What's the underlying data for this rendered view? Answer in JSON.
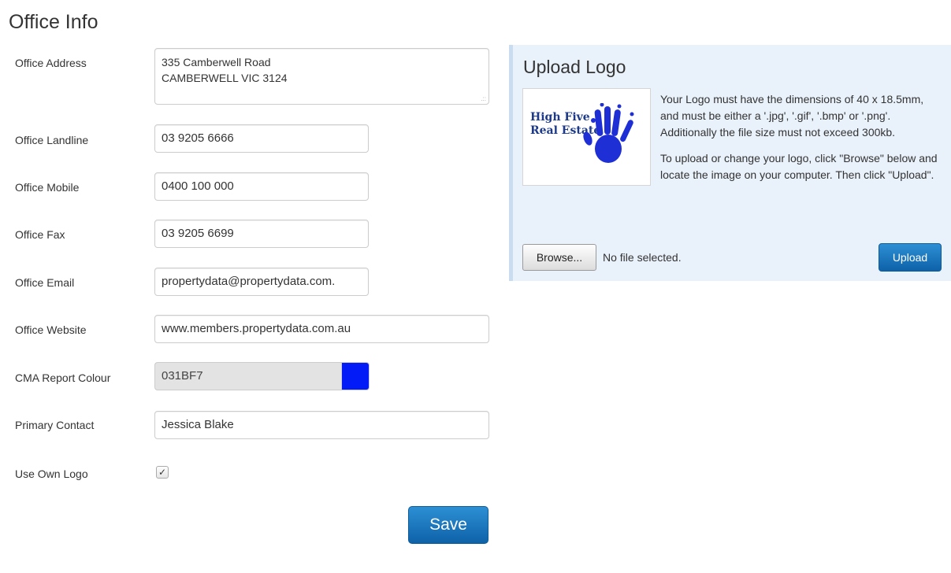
{
  "page_title": "Office Info",
  "form": {
    "address": {
      "label": "Office Address",
      "line1": "335 Camberwell Road",
      "line2": "CAMBERWELL VIC 3124"
    },
    "landline": {
      "label": "Office Landline",
      "value": "03 9205 6666"
    },
    "mobile": {
      "label": "Office Mobile",
      "value": "0400 100 000"
    },
    "fax": {
      "label": "Office Fax",
      "value": "03 9205 6699"
    },
    "email": {
      "label": "Office Email",
      "value": "propertydata@propertydata.com."
    },
    "website": {
      "label": "Office Website",
      "value": "www.members.propertydata.com.au"
    },
    "cma_colour": {
      "label": "CMA Report Colour",
      "value": "031BF7",
      "swatch_color": "#031BF7"
    },
    "primary_contact": {
      "label": "Primary Contact",
      "value": "Jessica Blake"
    },
    "use_own_logo": {
      "label": "Use Own Logo",
      "checked": true,
      "check_glyph": "✓"
    },
    "save_label": "Save"
  },
  "upload": {
    "title": "Upload Logo",
    "logo_text_line1": "High Five",
    "logo_text_line2": "Real Estate",
    "logo_hand_color": "#1f2fd6",
    "desc1": "Your Logo must have the dimensions of 40 x 18.5mm, and must be either a '.jpg', '.gif', '.bmp' or '.png'. Additionally the file size must not exceed 300kb.",
    "desc2": "To upload or change your logo, click \"Browse\" below and locate the image on your computer. Then click \"Upload\".",
    "browse_label": "Browse...",
    "file_status": "No file selected.",
    "upload_label": "Upload"
  }
}
